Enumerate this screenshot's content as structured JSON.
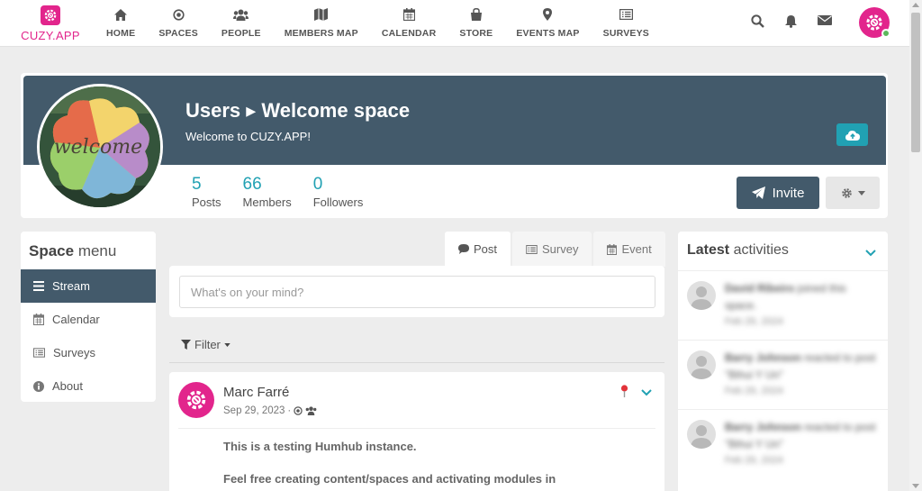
{
  "brand": {
    "name": "CUZY.APP",
    "color": "#e2258c"
  },
  "nav": [
    {
      "label": "HOME",
      "icon": "home-icon"
    },
    {
      "label": "SPACES",
      "icon": "dot-circle-icon"
    },
    {
      "label": "PEOPLE",
      "icon": "users-icon"
    },
    {
      "label": "MEMBERS MAP",
      "icon": "map-icon"
    },
    {
      "label": "CALENDAR",
      "icon": "calendar-icon"
    },
    {
      "label": "STORE",
      "icon": "shopping-bag-icon"
    },
    {
      "label": "EVENTS MAP",
      "icon": "map-marker-icon"
    },
    {
      "label": "SURVEYS",
      "icon": "list-alt-icon"
    }
  ],
  "space": {
    "title": "Users ▸ Welcome space",
    "description": "Welcome to CUZY.APP!",
    "image_text": "welcome",
    "banner_color": "#435a6b",
    "stats": [
      {
        "value": "5",
        "label": "Posts"
      },
      {
        "value": "66",
        "label": "Members"
      },
      {
        "value": "0",
        "label": "Followers"
      }
    ],
    "invite_label": "Invite"
  },
  "space_menu": {
    "title_bold": "Space",
    "title_rest": " menu",
    "items": [
      {
        "label": "Stream",
        "icon": "bars-icon",
        "active": true
      },
      {
        "label": "Calendar",
        "icon": "calendar-icon",
        "active": false
      },
      {
        "label": "Surveys",
        "icon": "list-alt-icon",
        "active": false
      },
      {
        "label": "About",
        "icon": "info-circle-icon",
        "active": false
      }
    ]
  },
  "composer": {
    "tabs": [
      {
        "label": "Post",
        "icon": "comment-icon",
        "active": true
      },
      {
        "label": "Survey",
        "icon": "list-alt-icon",
        "active": false
      },
      {
        "label": "Event",
        "icon": "calendar-icon",
        "active": false
      }
    ],
    "placeholder": "What's on your mind?"
  },
  "filter": {
    "label": "Filter"
  },
  "post": {
    "author": "Marc Farré",
    "date": "Sep 29, 2023",
    "body_line1": "This is a testing Humhub instance.",
    "body_line2": "Feel free creating content/spaces and activating modules in"
  },
  "activities": {
    "title_bold": "Latest",
    "title_rest": " activities",
    "items": [
      {
        "name": "David Ribeiro",
        "action": " joined this space.",
        "time": "Feb 29, 2024"
      },
      {
        "name": "Barry Johnson",
        "action": " reacted to post \"Bihui Y Un\"",
        "time": "Feb 29, 2024"
      },
      {
        "name": "Barry Johnson",
        "action": " reacted to post \"Bihui Y Un\"",
        "time": "Feb 29, 2024"
      }
    ]
  },
  "colors": {
    "accent": "#21a1b3",
    "brand": "#e2258c",
    "dark": "#435a6b",
    "online": "#5cb85c"
  }
}
